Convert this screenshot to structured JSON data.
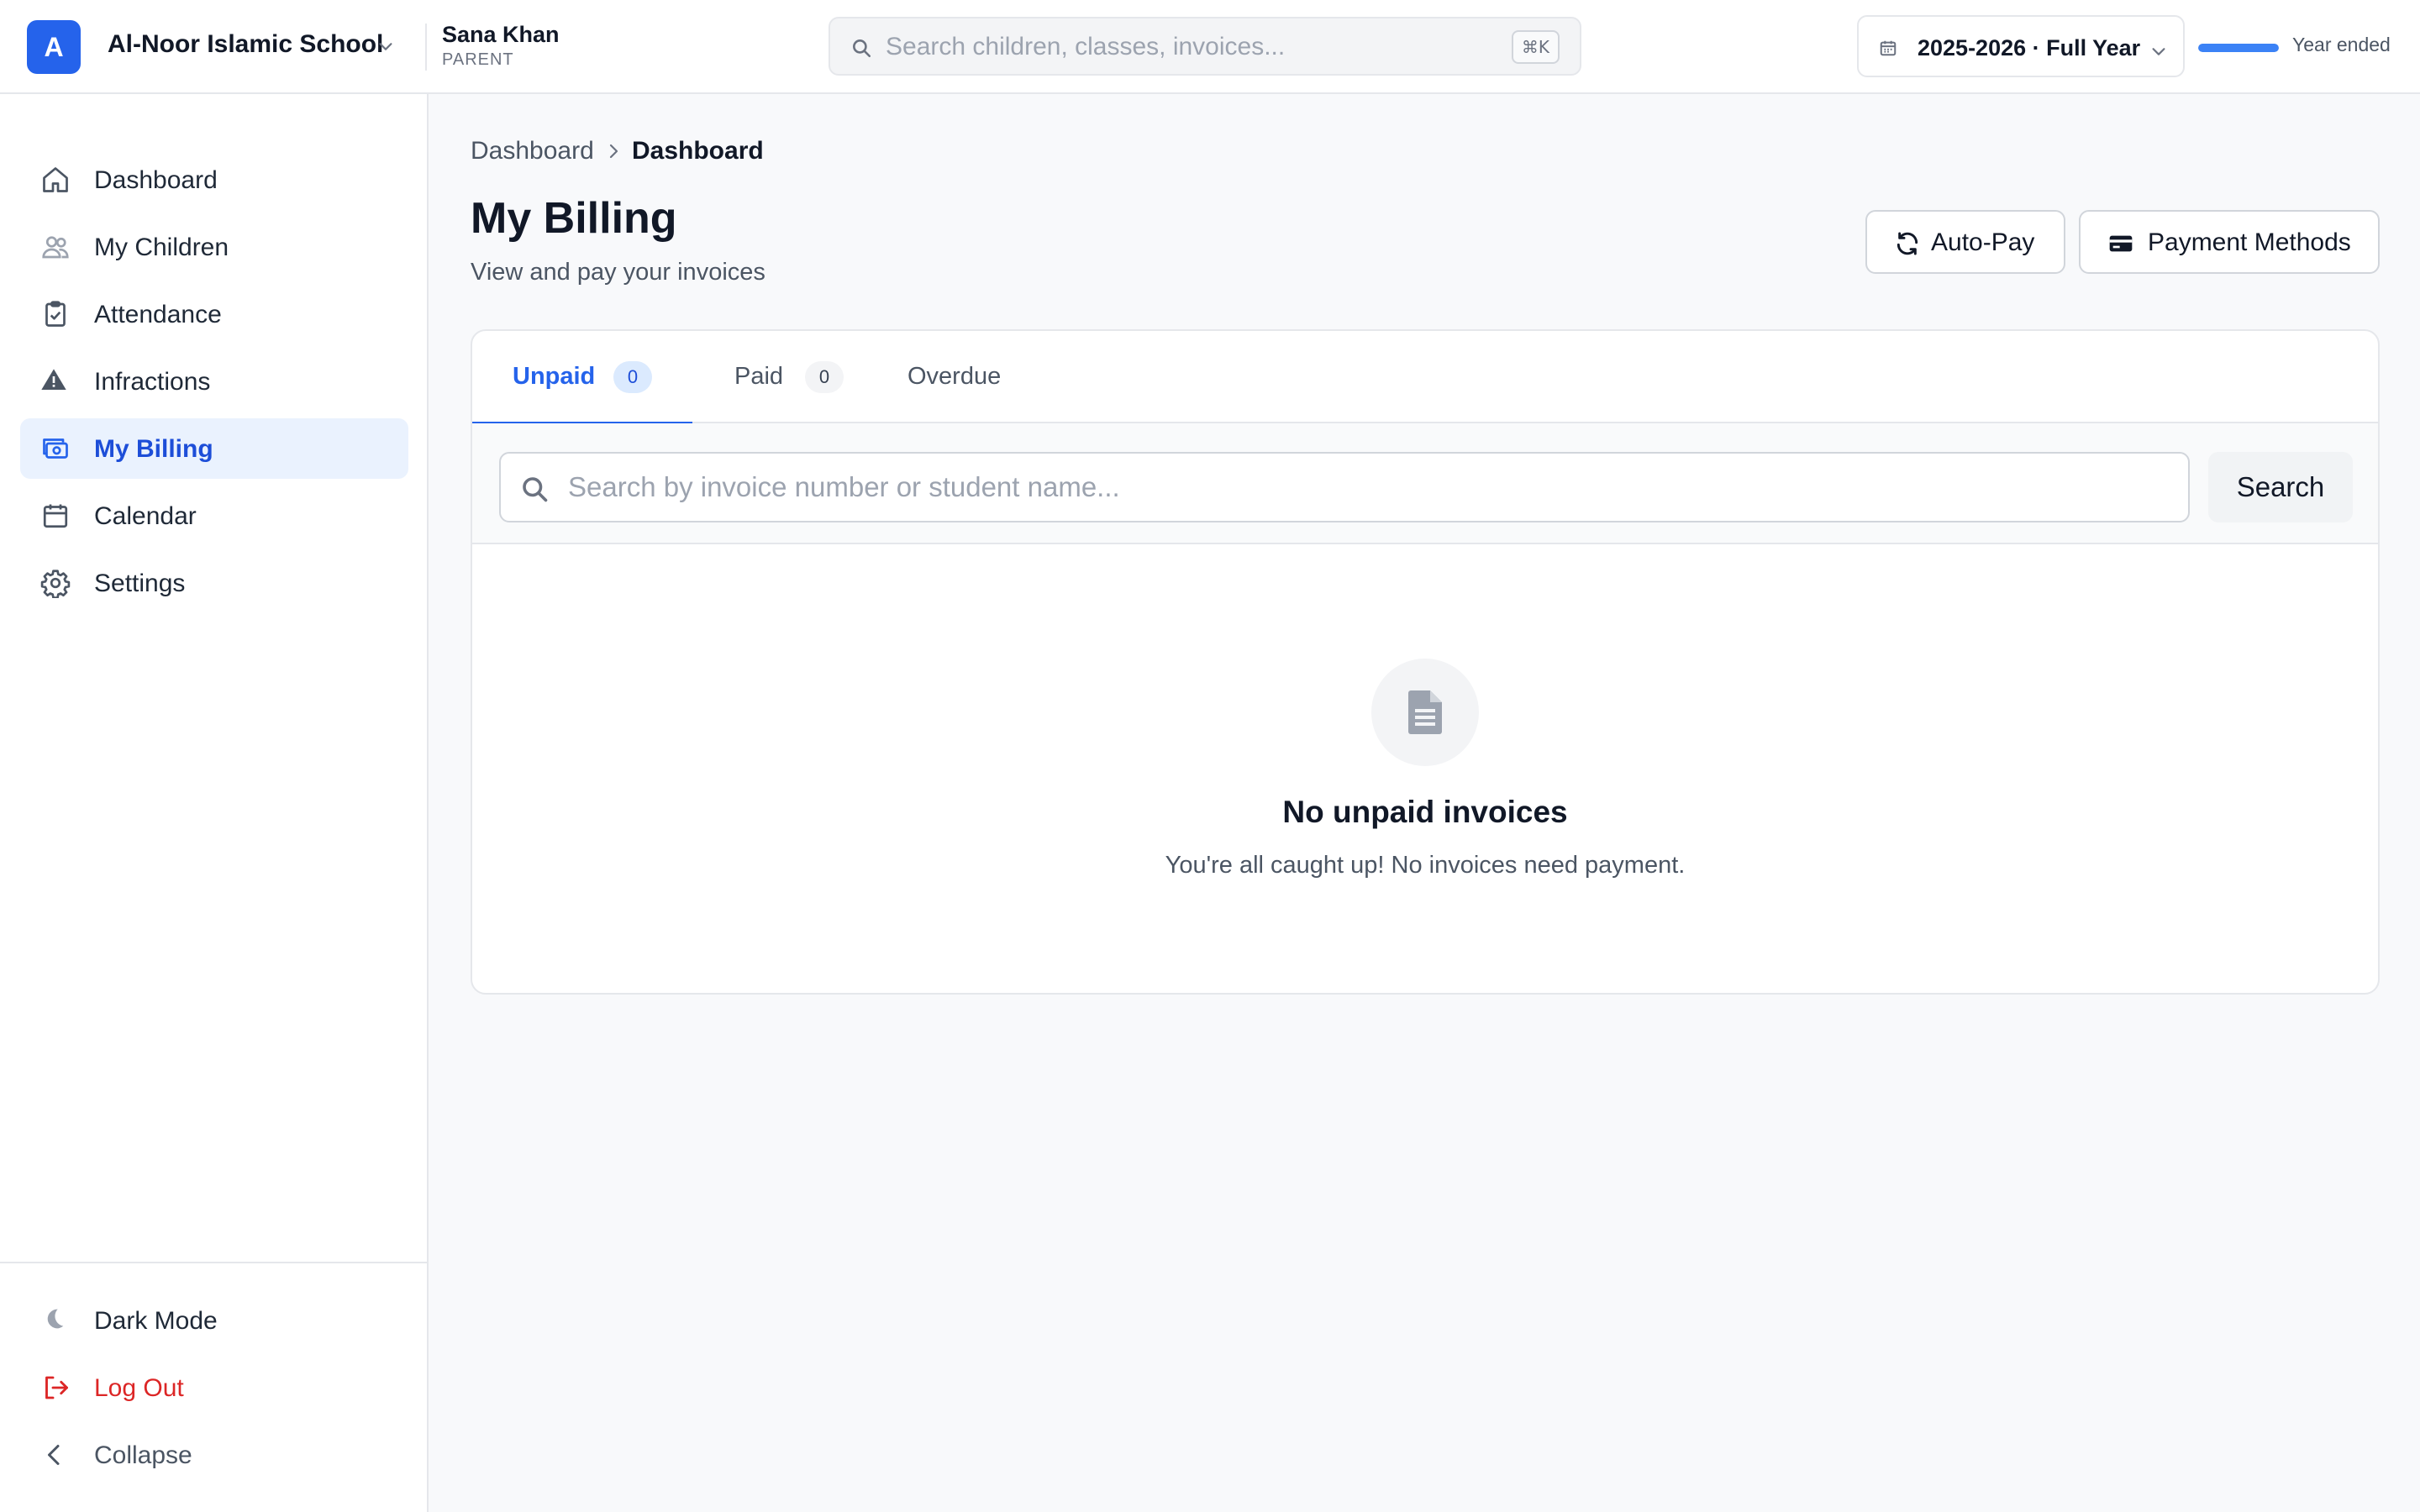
{
  "header": {
    "school_initial": "A",
    "school_name": "Al-Noor Islamic School",
    "user_name": "Sana Khan",
    "user_role": "PARENT",
    "search_placeholder": "Search children, classes, invoices...",
    "search_shortcut": "⌘K",
    "year_label": "2025-2026 · Full Year",
    "year_status": "Year ended",
    "year_progress": 1.0
  },
  "sidebar": {
    "items": [
      {
        "label": "Dashboard",
        "icon": "home-icon"
      },
      {
        "label": "My Children",
        "icon": "users-icon"
      },
      {
        "label": "Attendance",
        "icon": "clipboard-check-icon"
      },
      {
        "label": "Infractions",
        "icon": "warning-icon"
      },
      {
        "label": "My Billing",
        "icon": "billing-icon",
        "active": true
      },
      {
        "label": "Calendar",
        "icon": "calendar-icon"
      },
      {
        "label": "Settings",
        "icon": "gear-icon"
      }
    ],
    "bottom": {
      "dark_mode": "Dark Mode",
      "log_out": "Log Out",
      "collapse": "Collapse"
    }
  },
  "breadcrumb": {
    "root": "Dashboard",
    "current": "Dashboard"
  },
  "page": {
    "title": "My Billing",
    "subtitle": "View and pay your invoices",
    "autopay_label": "Auto-Pay",
    "payment_methods_label": "Payment Methods"
  },
  "tabs": [
    {
      "label": "Unpaid",
      "count": "0",
      "active": true
    },
    {
      "label": "Paid",
      "count": "0"
    },
    {
      "label": "Overdue"
    }
  ],
  "invoice_search": {
    "placeholder": "Search by invoice number or student name...",
    "value": "",
    "button_label": "Search"
  },
  "empty_state": {
    "icon": "document-icon",
    "title": "No unpaid invoices",
    "text": "You're all caught up! No invoices need payment."
  },
  "colors": {
    "accent": "#2563eb",
    "active_bg": "#eaf2fe",
    "danger": "#dc2626"
  }
}
